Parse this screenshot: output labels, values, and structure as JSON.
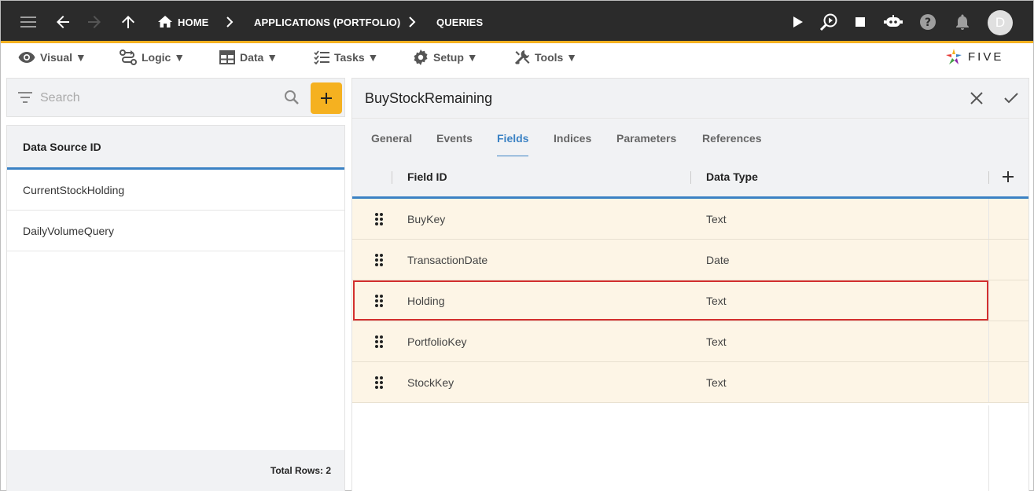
{
  "topbar": {
    "breadcrumb_home": "HOME",
    "breadcrumb_app": "APPLICATIONS (PORTFOLIO)",
    "breadcrumb_queries": "QUERIES",
    "avatar_initial": "D"
  },
  "menu": {
    "visual": "Visual ▼",
    "logic": "Logic ▼",
    "data": "Data ▼",
    "tasks": "Tasks ▼",
    "setup": "Setup ▼",
    "tools": "Tools ▼",
    "logo_text": "FIVE"
  },
  "left": {
    "search_placeholder": "Search",
    "column_header": "Data Source ID",
    "rows": [
      "CurrentStockHolding",
      "DailyVolumeQuery"
    ],
    "footer": "Total Rows: 2"
  },
  "right": {
    "title": "BuyStockRemaining",
    "tabs": [
      "General",
      "Events",
      "Fields",
      "Indices",
      "Parameters",
      "References"
    ],
    "active_tab": "Fields",
    "columns": [
      "Field ID",
      "Data Type"
    ],
    "rows": [
      {
        "field_id": "BuyKey",
        "data_type": "Text"
      },
      {
        "field_id": "TransactionDate",
        "data_type": "Date"
      },
      {
        "field_id": "Holding",
        "data_type": "Text"
      },
      {
        "field_id": "PortfolioKey",
        "data_type": "Text"
      },
      {
        "field_id": "StockKey",
        "data_type": "Text"
      }
    ],
    "selected_row": "Holding"
  },
  "colors": {
    "accent": "#f5b120",
    "tab_active": "#3b82c4",
    "row_bg": "#fdf5e6",
    "selection_border": "#d32f2f"
  }
}
